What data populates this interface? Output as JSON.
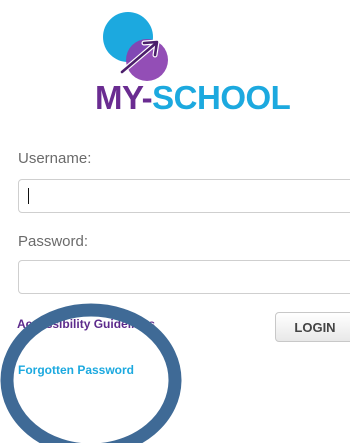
{
  "logo": {
    "text_my": "MY-",
    "text_school": "SCHOOL"
  },
  "form": {
    "username_label": "Username:",
    "username_value": "",
    "password_label": "Password:",
    "password_value": ""
  },
  "links": {
    "accessibility": "Accessibility Guidelines",
    "forgot_password": "Forgotten Password"
  },
  "buttons": {
    "login": "LOGIN"
  },
  "colors": {
    "brand_purple": "#6a2c91",
    "brand_blue": "#1ca9df",
    "highlight_ring": "#3f6a96"
  },
  "icons": {
    "logo": "my-school-logo-icon"
  }
}
